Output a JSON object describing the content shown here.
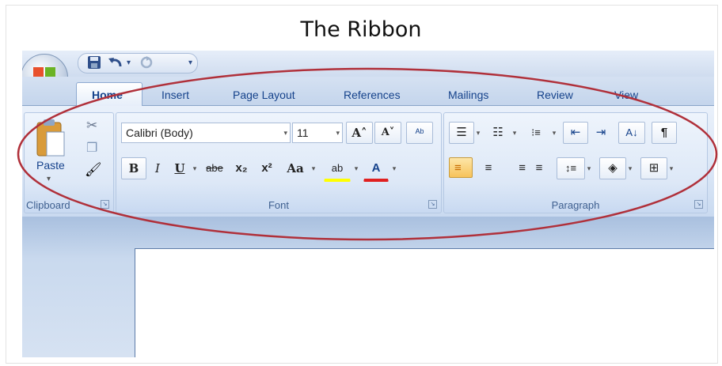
{
  "title": "The Ribbon",
  "quick_access": {
    "icons": [
      "save-icon",
      "undo-icon",
      "redo-icon",
      "customize-icon"
    ]
  },
  "tabs": [
    {
      "label": "Home",
      "active": true
    },
    {
      "label": "Insert"
    },
    {
      "label": "Page Layout"
    },
    {
      "label": "References"
    },
    {
      "label": "Mailings"
    },
    {
      "label": "Review"
    },
    {
      "label": "View"
    }
  ],
  "clipboard": {
    "group_label": "Clipboard",
    "paste_label": "Paste",
    "cut_glyph": "✂",
    "copy_glyph": "❐",
    "format_glyph": "🖌",
    "launcher_glyph": "↘",
    "dropdown_glyph": "▾"
  },
  "font": {
    "group_label": "Font",
    "font_name": "Calibri (Body)",
    "font_size": "11",
    "dropdown_glyph": "▾",
    "launcher_glyph": "↘",
    "grow_label": "A˄",
    "shrink_label": "A˅",
    "clear_label": "ᴬᵇ",
    "bold": "B",
    "italic": "I",
    "underline": "U",
    "strike": "abe",
    "subscript": "x₂",
    "superscript": "x²",
    "change_case": "Aa",
    "highlight": "ab",
    "font_color": "A"
  },
  "paragraph": {
    "group_label": "Paragraph",
    "launcher_glyph": "↘",
    "dropdown_glyph": "▾",
    "bullets": "☰",
    "numbering": "☷",
    "multilevel": "⁝≡",
    "decrease_indent": "⇤",
    "increase_indent": "⇥",
    "sort": "A↓",
    "show_marks": "¶",
    "align_left": "≡",
    "center": "≡",
    "align_right": "≡",
    "justify": "≡",
    "line_spacing": "↕≡",
    "shading": "◈",
    "borders": "⊞"
  },
  "colors": {
    "accent": "#15428b",
    "ellipse": "#b0303a",
    "active": "#f7c35b"
  }
}
